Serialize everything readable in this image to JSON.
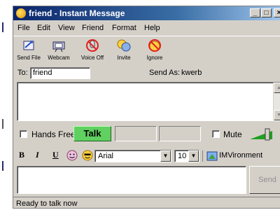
{
  "window": {
    "title": "friend - Instant Message",
    "minimize": "_",
    "maximize": "□",
    "close": "×"
  },
  "menu": [
    "File",
    "Edit",
    "View",
    "Friend",
    "Format",
    "Help"
  ],
  "toolbar": [
    {
      "label": "Send File",
      "icon": "send-file-icon"
    },
    {
      "label": "Webcam",
      "icon": "webcam-icon"
    },
    {
      "label": "Voice Off",
      "icon": "voice-off-icon"
    },
    {
      "label": "Invite",
      "icon": "invite-icon"
    },
    {
      "label": "Ignore",
      "icon": "ignore-icon"
    }
  ],
  "to": {
    "label": "To:",
    "value": "friend"
  },
  "send_as": {
    "label": "Send As:",
    "value": "kwerb"
  },
  "voice": {
    "hands_free": "Hands Free",
    "talk": "Talk",
    "mute": "Mute"
  },
  "format": {
    "bold": "B",
    "italic": "I",
    "underline": "U",
    "font": "Arial",
    "size": "10",
    "imvironment": "IMVironment"
  },
  "compose": {
    "send": "Send"
  },
  "status": {
    "text": "Ready to talk now"
  },
  "colors": {
    "talk_green": "#60d060",
    "titlebar": "#0a246a"
  }
}
